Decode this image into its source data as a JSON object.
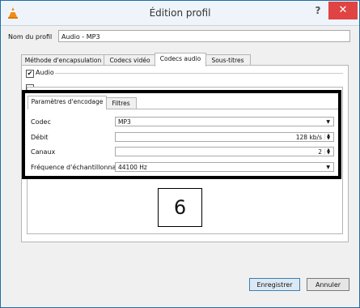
{
  "window": {
    "title": "Édition profil",
    "help_glyph": "?",
    "close_glyph": "✕"
  },
  "profile": {
    "name_label": "Nom du profil",
    "name_value": "Audio - MP3"
  },
  "outer_tabs": [
    {
      "label": "Méthode d'encapsulation"
    },
    {
      "label": "Codecs vidéo"
    },
    {
      "label": "Codecs audio"
    },
    {
      "label": "Sous-titres"
    }
  ],
  "audio_checkbox": {
    "label": "Audio",
    "checked": "✔"
  },
  "inner_tabs": [
    {
      "label": "Paramètres d'encodage"
    },
    {
      "label": "Filtres"
    }
  ],
  "settings": {
    "codec": {
      "label": "Codec",
      "value": "MP3"
    },
    "bitrate": {
      "label": "Débit",
      "value": "128 kb/s"
    },
    "channels": {
      "label": "Canaux",
      "value": "2"
    },
    "samplerate": {
      "label": "Fréquence d'échantillonnage",
      "value": "44100 Hz"
    }
  },
  "annotation": {
    "number": "6"
  },
  "buttons": {
    "save": "Enregistrer",
    "cancel": "Annuler"
  },
  "colors": {
    "close": "#e04343",
    "accent": "#1d6ea6"
  }
}
